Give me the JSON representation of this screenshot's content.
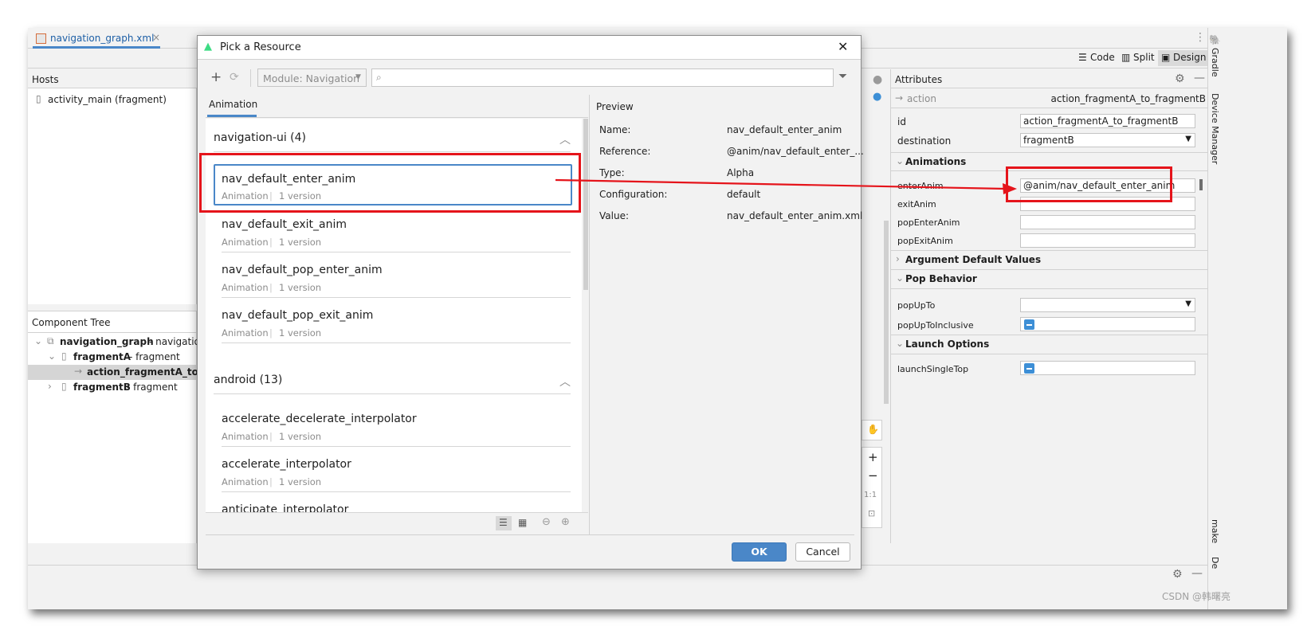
{
  "editor_tab": {
    "label": "navigation_graph.xml"
  },
  "view_modes": {
    "code": "Code",
    "split": "Split",
    "design": "Design"
  },
  "hosts": {
    "title": "Hosts",
    "items": [
      "activity_main (fragment)"
    ]
  },
  "component_tree": {
    "title": "Component Tree",
    "root": {
      "name": "navigation_graph",
      "type": "- navigation"
    },
    "fragmentA": {
      "name": "fragmentA",
      "type": "- fragment"
    },
    "action": {
      "name": "action_fragmentA_to_fra"
    },
    "fragmentB": {
      "name": "fragmentB",
      "type": "- fragment"
    }
  },
  "attributes": {
    "title": "Attributes",
    "header_type": "action",
    "header_value": "action_fragmentA_to_fragmentB",
    "id_label": "id",
    "id_value": "action_fragmentA_to_fragmentB",
    "destination_label": "destination",
    "destination_value": "fragmentB",
    "animations_section": "Animations",
    "enter_anim_label": "enterAnim",
    "enter_anim_value": "@anim/nav_default_enter_anim",
    "exit_anim_label": "exitAnim",
    "pop_enter_anim_label": "popEnterAnim",
    "pop_exit_anim_label": "popExitAnim",
    "arg_defaults_section": "Argument Default Values",
    "pop_behavior_section": "Pop Behavior",
    "pop_up_to_label": "popUpTo",
    "pop_up_to_inclusive_label": "popUpToInclusive",
    "launch_options_section": "Launch Options",
    "launch_single_top_label": "launchSingleTop"
  },
  "side_tools": {
    "gradle": "Gradle",
    "device_manager": "Device Manager",
    "make": "make",
    "bottom": "De"
  },
  "dialog": {
    "title": "Pick a Resource",
    "module_select": "Module: Navigation",
    "search_placeholder": "",
    "tab": "Animation",
    "groups": [
      {
        "name": "navigation-ui (4)",
        "items": [
          {
            "name": "nav_default_enter_anim",
            "type": "Animation",
            "versions": "1 version"
          },
          {
            "name": "nav_default_exit_anim",
            "type": "Animation",
            "versions": "1 version"
          },
          {
            "name": "nav_default_pop_enter_anim",
            "type": "Animation",
            "versions": "1 version"
          },
          {
            "name": "nav_default_pop_exit_anim",
            "type": "Animation",
            "versions": "1 version"
          }
        ]
      },
      {
        "name": "android (13)",
        "items": [
          {
            "name": "accelerate_decelerate_interpolator",
            "type": "Animation",
            "versions": "1 version"
          },
          {
            "name": "accelerate_interpolator",
            "type": "Animation",
            "versions": "1 version"
          },
          {
            "name": "anticipate_interpolator",
            "type": "",
            "versions": ""
          }
        ]
      }
    ],
    "preview": {
      "title": "Preview",
      "rows": [
        {
          "label": "Name:",
          "value": "nav_default_enter_anim"
        },
        {
          "label": "Reference:",
          "value": "@anim/nav_default_enter_..."
        },
        {
          "label": "Type:",
          "value": "Alpha"
        },
        {
          "label": "Configuration:",
          "value": "default"
        },
        {
          "label": "Value:",
          "value": "nav_default_enter_anim.xml"
        }
      ]
    },
    "ok": "OK",
    "cancel": "Cancel"
  },
  "zoom": {
    "fit": "1:1"
  },
  "watermark": "CSDN @韩曙亮",
  "colors": {
    "accent": "#3d8fd6",
    "highlight": "#e5141b",
    "primary_button": "#4a87c8"
  }
}
